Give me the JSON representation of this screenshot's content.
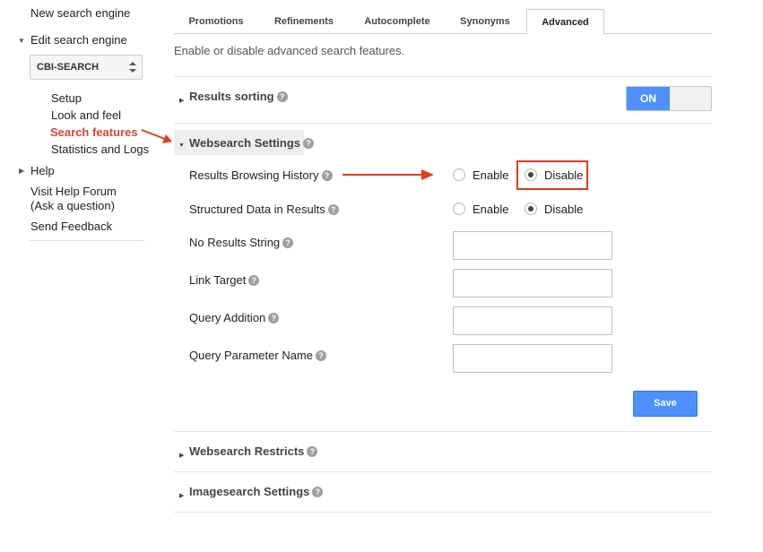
{
  "sidebar": {
    "new_engine": "New search engine",
    "edit_engine": "Edit search engine",
    "engine_selected": "CBI-SEARCH",
    "sub_items": [
      {
        "label": "Setup"
      },
      {
        "label": "Look and feel"
      },
      {
        "label": "Search features"
      },
      {
        "label": "Statistics and Logs"
      }
    ],
    "help": "Help",
    "help_forum_line1": "Visit Help Forum",
    "help_forum_line2": "(Ask a question)",
    "send_feedback": "Send Feedback"
  },
  "tabs": [
    {
      "label": "Promotions"
    },
    {
      "label": "Refinements"
    },
    {
      "label": "Autocomplete"
    },
    {
      "label": "Synonyms"
    },
    {
      "label": "Advanced"
    }
  ],
  "active_tab": "Advanced",
  "intro": "Enable or disable advanced search features.",
  "results_sorting": {
    "title": "Results sorting",
    "toggle_label": "ON"
  },
  "websearch_settings": {
    "title": "Websearch Settings",
    "rows": [
      {
        "label": "Results Browsing History",
        "enable": "Enable",
        "disable": "Disable",
        "selected": "Disable"
      },
      {
        "label": "Structured Data in Results",
        "enable": "Enable",
        "disable": "Disable",
        "selected": "Disable"
      }
    ],
    "fields": [
      {
        "label": "No Results String",
        "value": ""
      },
      {
        "label": "Link Target",
        "value": ""
      },
      {
        "label": "Query Addition",
        "value": ""
      },
      {
        "label": "Query Parameter Name",
        "value": ""
      }
    ],
    "save_label": "Save"
  },
  "websearch_restricts": {
    "title": "Websearch Restricts"
  },
  "imagesearch_settings": {
    "title": "Imagesearch Settings"
  },
  "help_glyph": "?",
  "expand_glyphs": {
    "collapsed": "▶",
    "expanded": "▼"
  },
  "colors": {
    "accent": "#4d90fe",
    "active_link": "#d14836",
    "annotation": "#e53a1f"
  }
}
